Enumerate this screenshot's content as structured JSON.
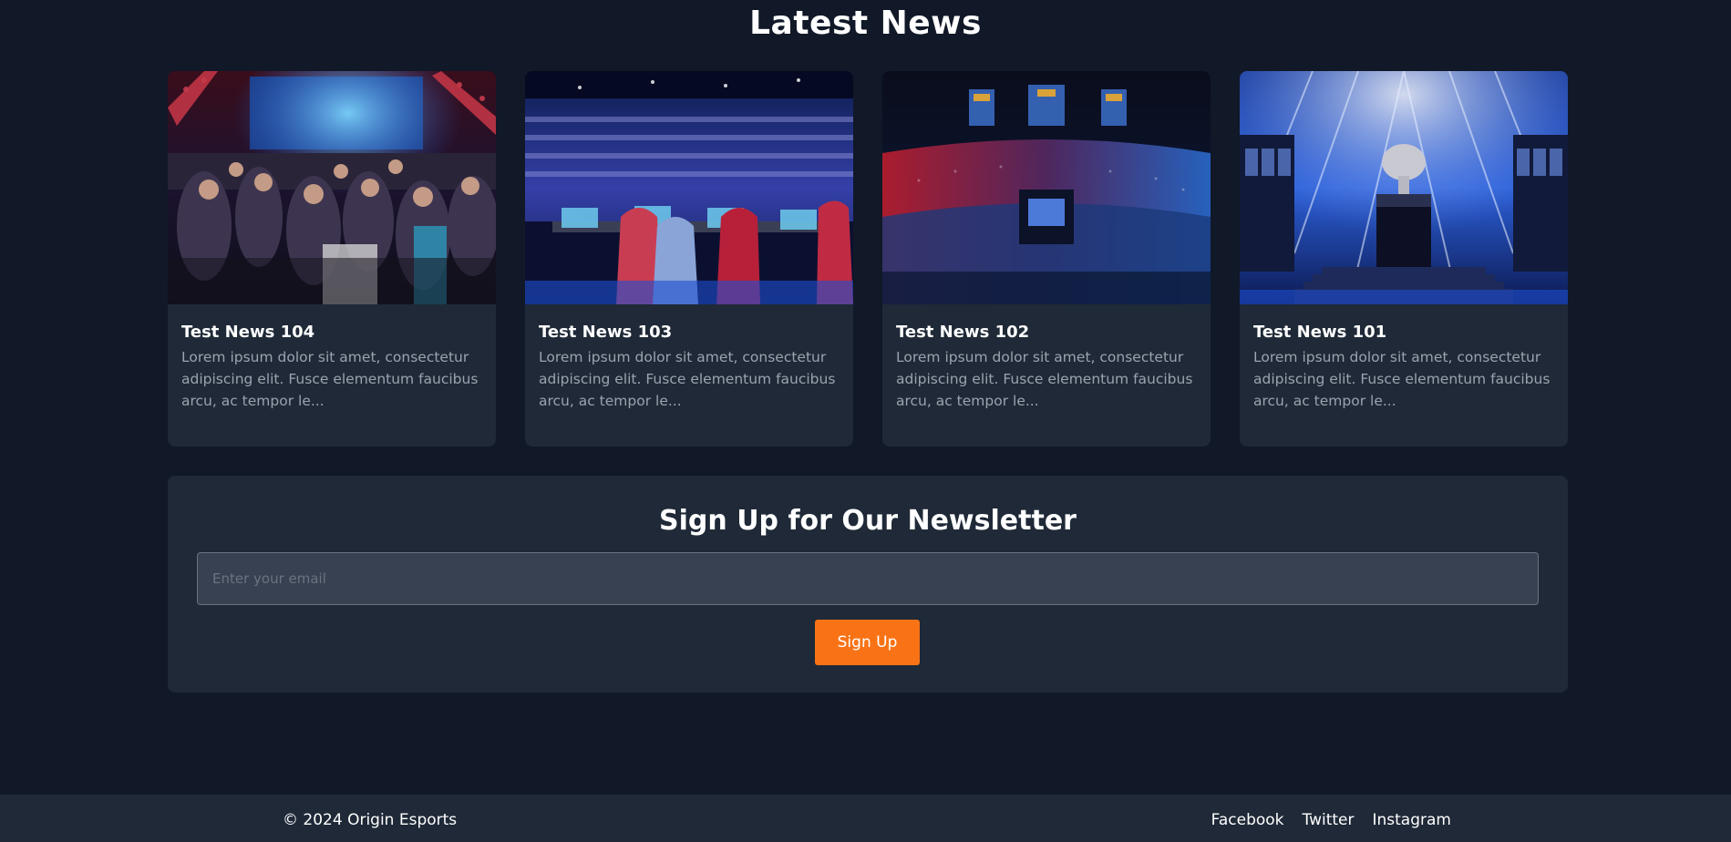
{
  "news": {
    "title": "Latest News",
    "cards": [
      {
        "title": "Test News 104",
        "excerpt": "Lorem ipsum dolor sit amet, consectetur adipiscing elit. Fusce elementum faucibus arcu, ac tempor le..."
      },
      {
        "title": "Test News 103",
        "excerpt": "Lorem ipsum dolor sit amet, consectetur adipiscing elit. Fusce elementum faucibus arcu, ac tempor le..."
      },
      {
        "title": "Test News 102",
        "excerpt": "Lorem ipsum dolor sit amet, consectetur adipiscing elit. Fusce elementum faucibus arcu, ac tempor le..."
      },
      {
        "title": "Test News 101",
        "excerpt": "Lorem ipsum dolor sit amet, consectetur adipiscing elit. Fusce elementum faucibus arcu, ac tempor le..."
      }
    ]
  },
  "newsletter": {
    "title": "Sign Up for Our Newsletter",
    "email_placeholder": "Enter your email",
    "email_value": "",
    "button_label": "Sign Up"
  },
  "footer": {
    "copyright": "© 2024 Origin Esports",
    "links": [
      "Facebook",
      "Twitter",
      "Instagram"
    ]
  },
  "colors": {
    "page_bg": "#111827",
    "card_bg": "#1f2937",
    "input_bg": "#374151",
    "accent": "#f97316",
    "muted_text": "#9ca3af"
  }
}
